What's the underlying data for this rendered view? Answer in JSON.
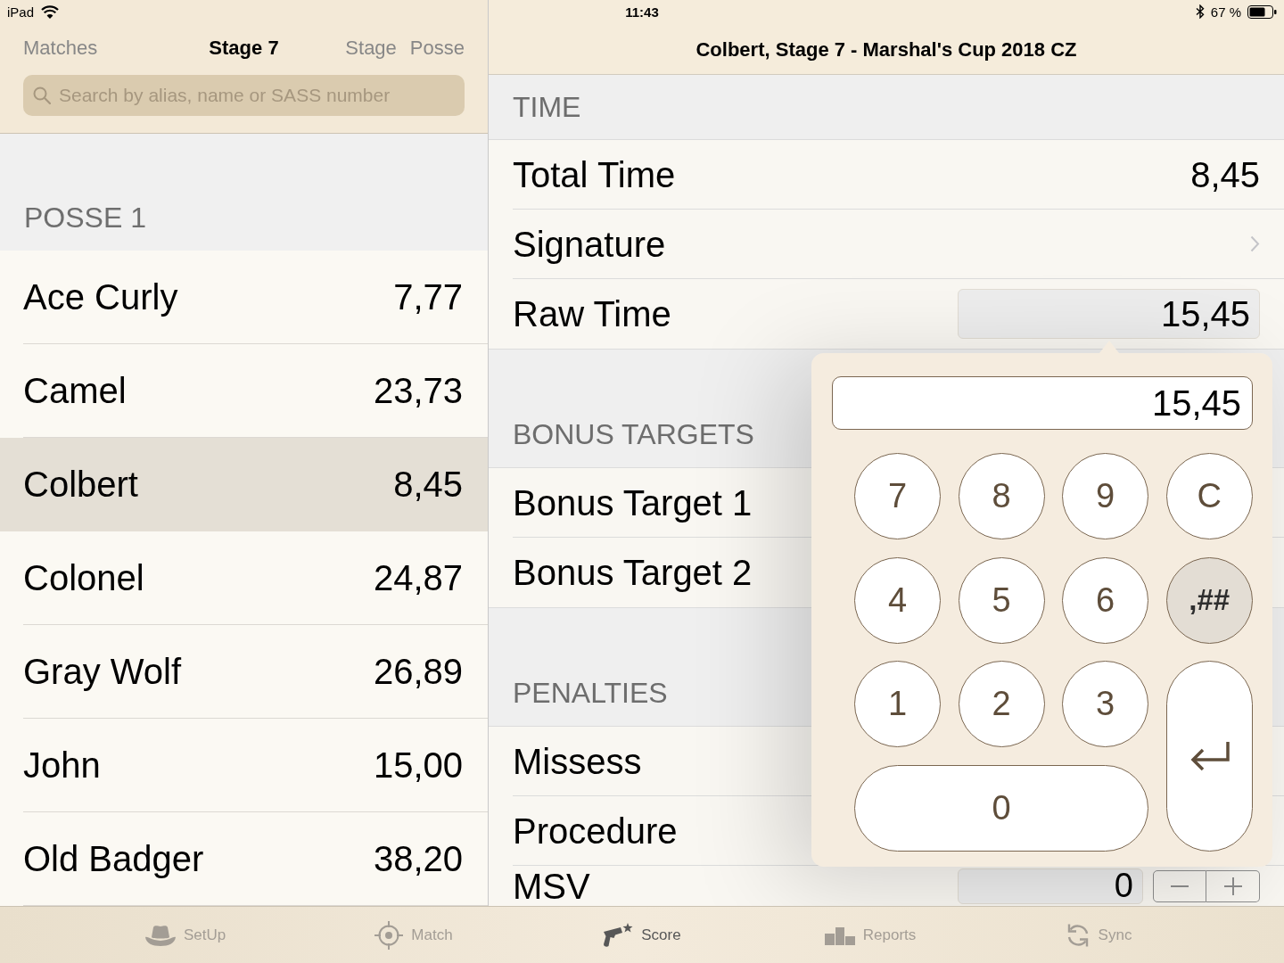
{
  "status_bar": {
    "device": "iPad",
    "time": "11:43",
    "battery": "67 %"
  },
  "sidebar": {
    "back": "Matches",
    "title": "Stage 7",
    "actions": [
      "Stage",
      "Posse"
    ],
    "search": {
      "placeholder": "Search by alias, name or SASS number"
    },
    "groups": [
      {
        "title": "POSSE 1",
        "rows": [
          {
            "name": "Ace Curly",
            "time": "7,77",
            "selected": false
          },
          {
            "name": "Camel",
            "time": "23,73",
            "selected": false
          },
          {
            "name": "Colbert",
            "time": "8,45",
            "selected": true
          },
          {
            "name": "Colonel",
            "time": "24,87",
            "selected": false
          },
          {
            "name": "Gray Wolf",
            "time": "26,89",
            "selected": false
          },
          {
            "name": "John",
            "time": "15,00",
            "selected": false
          },
          {
            "name": "Old Badger",
            "time": "38,20",
            "selected": false
          }
        ]
      }
    ]
  },
  "detail": {
    "title": "Colbert, Stage 7 - Marshal's Cup 2018 CZ",
    "sections": [
      {
        "title": "TIME",
        "rows": [
          {
            "kind": "value",
            "label": "Total Time",
            "value": "8,45"
          },
          {
            "kind": "link",
            "label": "Signature"
          },
          {
            "kind": "input",
            "label": "Raw Time",
            "value": "15,45"
          }
        ]
      },
      {
        "title": "BONUS TARGETS",
        "rows": [
          {
            "kind": "plain",
            "label": "Bonus Target 1"
          },
          {
            "kind": "plain",
            "label": "Bonus Target 2"
          }
        ]
      },
      {
        "title": "PENALTIES",
        "rows": [
          {
            "kind": "plain",
            "label": "Missess"
          },
          {
            "kind": "plain",
            "label": "Procedure"
          },
          {
            "kind": "stepper",
            "label": "MSV",
            "value": "0"
          }
        ]
      }
    ]
  },
  "keypad": {
    "display": "15,45",
    "keys": [
      {
        "kind": "digit",
        "label": "7",
        "on": false
      },
      {
        "kind": "digit",
        "label": "8",
        "on": false
      },
      {
        "kind": "digit",
        "label": "9",
        "on": false
      },
      {
        "kind": "clear",
        "label": "C",
        "on": false
      },
      {
        "kind": "digit",
        "label": "4",
        "on": false
      },
      {
        "kind": "digit",
        "label": "5",
        "on": false
      },
      {
        "kind": "digit",
        "label": "6",
        "on": false
      },
      {
        "kind": "decimal",
        "label": ",##",
        "on": true
      },
      {
        "kind": "digit",
        "label": "1",
        "on": false
      },
      {
        "kind": "digit",
        "label": "2",
        "on": false
      },
      {
        "kind": "digit",
        "label": "3",
        "on": false
      },
      {
        "kind": "enter",
        "on": false
      },
      {
        "kind": "wide",
        "label": "0",
        "on": false
      }
    ]
  },
  "tab_bar": {
    "items": [
      {
        "label": "SetUp",
        "selected": false
      },
      {
        "label": "Match",
        "selected": false
      },
      {
        "label": "Score",
        "selected": true
      },
      {
        "label": "Reports",
        "selected": false
      },
      {
        "label": "Sync",
        "selected": false
      }
    ]
  }
}
